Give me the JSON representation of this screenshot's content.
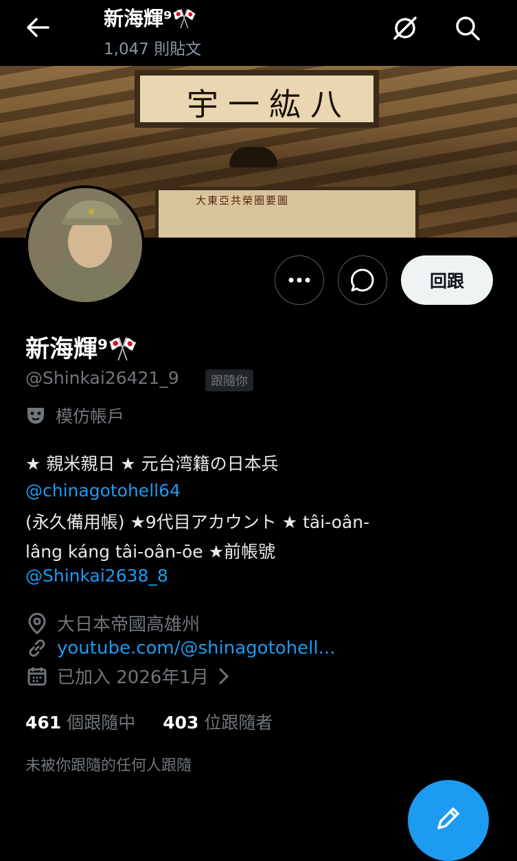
{
  "header": {
    "title": "新海輝⁹🎌",
    "post_count": "1,047 則貼文",
    "back_icon": "arrow-left-icon",
    "grok_icon": "grok-icon",
    "search_icon": "search-icon"
  },
  "banner": {
    "plaque_text": "宇一紘八",
    "map_text": "大東亞共榮圈要圖"
  },
  "actions": {
    "more_icon": "more-icon",
    "message_icon": "message-icon",
    "follow_back_label": "回跟"
  },
  "profile": {
    "display_name": "新海輝⁹🎌",
    "handle": "@Shinkai26421_9",
    "follows_you_badge": "跟隨你",
    "parody_label": "模仿帳戶",
    "parody_icon": "theater-mask-icon"
  },
  "bio": {
    "line1": "★ 親米親日 ★ 元台湾籍の日本兵",
    "mention1": "@chinagotohell64",
    "line3": "(永久備用帳) ★9代目アカウント ★ tâi-oân-",
    "line4": "lâng káng tâi-oân-ōe ★前帳號",
    "mention2": "@Shinkai2638_8"
  },
  "meta": {
    "location": "大日本帝國高雄州",
    "website": "youtube.com/@shinagotohell...",
    "joined": "已加入 2026年1月"
  },
  "stats": {
    "following_count": "461",
    "following_label": "個跟隨中",
    "followers_count": "403",
    "followers_label": "位跟隨者"
  },
  "followed_by_note": "未被你跟隨的任何人跟隨",
  "colors": {
    "background": "#000000",
    "accent": "#1d9bf0",
    "secondary_text": "#71767b"
  }
}
